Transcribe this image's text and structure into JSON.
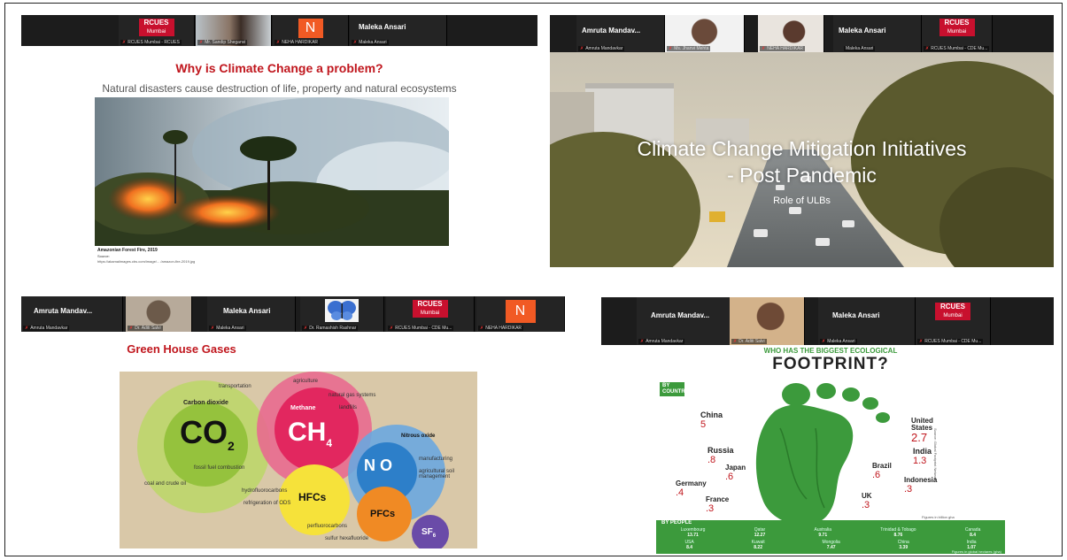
{
  "p1": {
    "tiles": [
      {
        "name": "",
        "caption": "RCUES Mumbai - RCUES",
        "logo": "RCUES",
        "logo_sub": "Mumbai"
      },
      {
        "name": "",
        "caption": "Mr. Sandip Sheganvi"
      },
      {
        "name": "",
        "caption": "NEHA HARDIKAR",
        "logo": "N"
      },
      {
        "name": "Maleka Ansari",
        "caption": "Maleka Ansari"
      }
    ],
    "title": "Why is Climate Change a problem?",
    "subtitle": "Natural disasters cause destruction of life, property and natural ecosystems",
    "caption": "Amazonian Forest Fire, 2019",
    "source_label": "Source:",
    "source_url": "https://akamaiimages.cbs.com/image/... /amazon-fire-2019.jpg"
  },
  "p2": {
    "tiles": [
      {
        "name": "Amruta Mandav...",
        "caption": "Amruta Mandavkar"
      },
      {
        "name": "",
        "caption": "Ms. Jhanvi Mehta"
      },
      {
        "name": "",
        "caption": "NEHA HARDIKAR"
      },
      {
        "name": "Maleka Ansari",
        "caption": "Maleka Ansari"
      },
      {
        "name": "",
        "caption": "RCUES Mumbai - CDE Mu...",
        "logo": "RCUES",
        "logo_sub": "Mumbai"
      }
    ],
    "title_line1": "Climate Change Mitigation Initiatives",
    "title_line2": "- Post Pandemic",
    "subtitle": "Role of ULBs"
  },
  "p3": {
    "tiles": [
      {
        "name": "Amruta Mandav...",
        "caption": "Amruta Mandavkar"
      },
      {
        "name": "",
        "caption": "Dr. Aditi Salvi"
      },
      {
        "name": "Maleka Ansari",
        "caption": "Maleka Ansari"
      },
      {
        "name": "",
        "caption": "Dr. Ramashish Rashnar"
      },
      {
        "name": "",
        "caption": "RCUES Mumbai - CDE Mu...",
        "logo": "RCUES",
        "logo_sub": "Mumbai"
      },
      {
        "name": "",
        "caption": "NEHA HARDIKAR",
        "logo": "N"
      }
    ],
    "title": "Green House Gases",
    "gases": {
      "co2_name": "Carbon dioxide",
      "co2": "CO",
      "ch4_name": "Methane",
      "ch4": "CH",
      "n2o_name": "Nitrous oxide",
      "n2o": "N O",
      "hfc": "HFCs",
      "pfc": "PFCs",
      "sf6": "SF"
    },
    "labels": {
      "transportation": "transportation",
      "agriculture": "agriculture",
      "natural_gas": "natural gas systems",
      "landfills": "landfills",
      "fossil_fuel": "fossil fuel combustion",
      "coal": "coal and crude oil",
      "hydrofluorocarbons": "hydrofluorocarbons",
      "refrigeration": "refrigeration of ODS",
      "manufacturing": "manufacturing",
      "agricultural_soil": "agricultural soil management",
      "perfluorocarbons": "perfluorocarbons",
      "sulfur": "sulfur hexafluoride"
    }
  },
  "p4": {
    "tiles": [
      {
        "name": "Amruta Mandav...",
        "caption": "Amruta Mandavkar"
      },
      {
        "name": "",
        "caption": "Dr. Aditi Salvi"
      },
      {
        "name": "Maleka Ansari",
        "caption": "Maleka Ansari"
      },
      {
        "name": "",
        "caption": "RCUES Mumbai - CDE Mu...",
        "logo": "RCUES",
        "logo_sub": "Mumbai"
      }
    ],
    "heading_small": "WHO HAS THE BIGGEST ECOLOGICAL",
    "heading_big": "FOOTPRINT?",
    "by_country": "BY COUNTRY",
    "countries": [
      {
        "name": "China",
        "value": "5"
      },
      {
        "name": "United States",
        "value": "2.7"
      },
      {
        "name": "Russia",
        "value": ".8"
      },
      {
        "name": "India",
        "value": "1.3"
      },
      {
        "name": "Japan",
        "value": ".6"
      },
      {
        "name": "Brazil",
        "value": ".6"
      },
      {
        "name": "Germany",
        "value": ".4"
      },
      {
        "name": "Indonesia",
        "value": ".3"
      },
      {
        "name": "France",
        "value": ".3"
      },
      {
        "name": "UK",
        "value": ".3"
      }
    ],
    "figures_note": "Figures in billion gha",
    "source_note": "Source: Global Footprint Network",
    "by_people": "BY PEOPLE",
    "people": [
      {
        "name": "Luxembourg",
        "value": "13.71"
      },
      {
        "name": "Qatar",
        "value": "12.27"
      },
      {
        "name": "Australia",
        "value": "9.71"
      },
      {
        "name": "Trinidad & Tobago",
        "value": "8.76"
      },
      {
        "name": "Canada",
        "value": "8.4"
      },
      {
        "name": "USA",
        "value": "8.4"
      },
      {
        "name": "Kuwait",
        "value": "8.22"
      },
      {
        "name": "Mongolia",
        "value": "7.47"
      },
      {
        "name": "China",
        "value": "3.39"
      },
      {
        "name": "India",
        "value": "1.07"
      }
    ],
    "people_note": "Figures in global hectares (gha)",
    "colors": {
      "green": "#3c9a3c",
      "dark": "#222222"
    }
  }
}
